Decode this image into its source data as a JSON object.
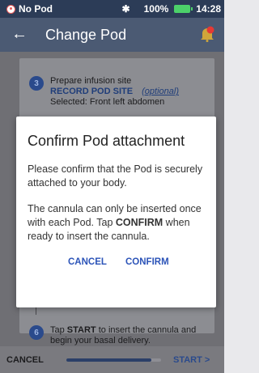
{
  "status_bar": {
    "pod_status": "No Pod",
    "bluetooth_icon": "bluetooth-icon",
    "battery_percent": "100%",
    "battery_color": "#4cd16a",
    "time": "14:28"
  },
  "app_bar": {
    "back_icon": "←",
    "title": "Change Pod",
    "notification_icon": "bell-icon",
    "notification_badge_color": "#e53935"
  },
  "steps": [
    {
      "number": "3",
      "title": "Prepare infusion site",
      "record_label": "RECORD POD SITE",
      "optional_label": "(optional)",
      "selected": "Selected: Front left abdomen"
    },
    {
      "number": "6",
      "line1": "Tap START to insert the cannula and",
      "line2": "begin your basal delivery.",
      "bold_word": "START"
    }
  ],
  "dialog": {
    "title": "Confirm Pod attachment",
    "paragraph1": "Please confirm that the Pod is securely attached to your body.",
    "paragraph2_part1": "The cannula can only be inserted once with each Pod. Tap ",
    "paragraph2_bold": "CONFIRM",
    "paragraph2_part2": " when ready to insert the cannula.",
    "cancel_label": "CANCEL",
    "confirm_label": "CONFIRM"
  },
  "bottom_bar": {
    "cancel_label": "CANCEL",
    "start_label": "START",
    "start_chevron": ">",
    "progress_fraction": 0.9
  },
  "colors": {
    "status_bar_bg": "#2c3c57",
    "app_bar_bg": "#4b5a73",
    "accent": "#2c54b8"
  }
}
